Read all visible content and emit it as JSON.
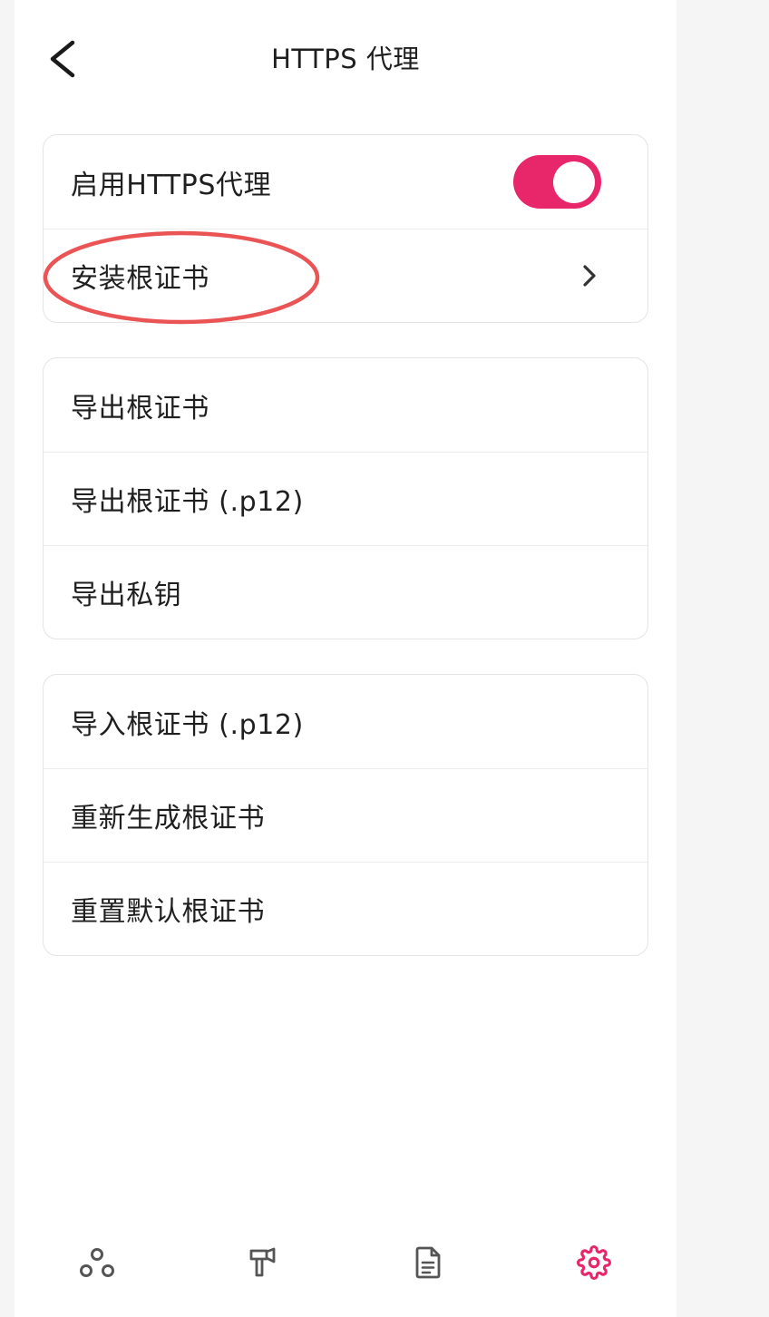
{
  "header": {
    "title": "HTTPS 代理",
    "back_icon": "chevron-left-icon"
  },
  "groups": [
    {
      "items": [
        {
          "label": "启用HTTPS代理",
          "toggle": {
            "checked": true
          }
        },
        {
          "label": "安装根证书",
          "icon": "chevron-right-icon",
          "highlighted": true
        }
      ]
    },
    {
      "items": [
        {
          "label": "导出根证书"
        },
        {
          "label": "导出根证书 (.p12)"
        },
        {
          "label": "导出私钥"
        }
      ]
    },
    {
      "items": [
        {
          "label": "导入根证书 (.p12)"
        },
        {
          "label": "重新生成根证书"
        },
        {
          "label": "重置默认根证书"
        }
      ]
    }
  ],
  "bottom_nav": [
    {
      "icon": "nodes-icon",
      "active": false
    },
    {
      "icon": "hammer-icon",
      "active": false
    },
    {
      "icon": "document-icon",
      "active": false
    },
    {
      "icon": "gear-icon",
      "active": true
    }
  ],
  "colors": {
    "accent": "#e8266a",
    "annotation": "#ea5455",
    "text": "#1f1f1f",
    "icon_inactive": "#555555",
    "page_background": "#f5f5f5",
    "panel_background": "#ffffff",
    "card_border": "#e4e4e4",
    "divider": "#ececec"
  }
}
